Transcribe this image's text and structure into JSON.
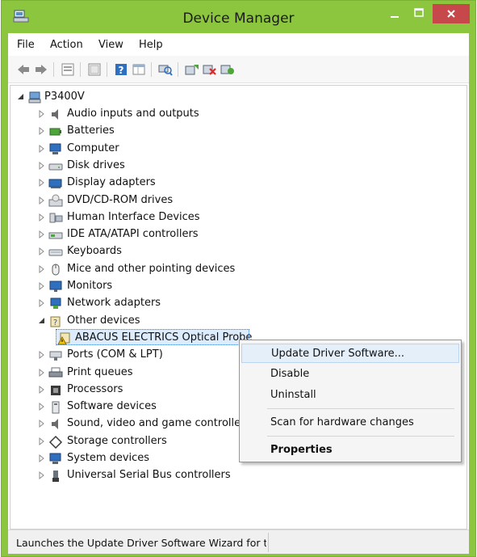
{
  "window": {
    "title": "Device Manager",
    "accent_color": "#8cc63e",
    "close_color": "#c7484a"
  },
  "menu": [
    "File",
    "Action",
    "View",
    "Help"
  ],
  "toolbar": {
    "icons": [
      "back-arrow-icon",
      "forward-arrow-icon",
      "properties-sheet-icon",
      "console-tree-icon",
      "help-icon",
      "grid-icon",
      "scan-hardware-icon",
      "update-driver-icon",
      "uninstall-device-icon",
      "add-legacy-icon"
    ]
  },
  "tree": {
    "root": "P3400V",
    "items": [
      {
        "label": "Audio inputs and outputs",
        "icon": "speaker-icon"
      },
      {
        "label": "Batteries",
        "icon": "battery-icon"
      },
      {
        "label": "Computer",
        "icon": "computer-icon"
      },
      {
        "label": "Disk drives",
        "icon": "disk-drive-icon"
      },
      {
        "label": "Display adapters",
        "icon": "display-adapter-icon"
      },
      {
        "label": "DVD/CD-ROM drives",
        "icon": "dvd-drive-icon"
      },
      {
        "label": "Human Interface Devices",
        "icon": "hid-icon"
      },
      {
        "label": "IDE ATA/ATAPI controllers",
        "icon": "ide-controller-icon"
      },
      {
        "label": "Keyboards",
        "icon": "keyboard-icon"
      },
      {
        "label": "Mice and other pointing devices",
        "icon": "mouse-icon"
      },
      {
        "label": "Monitors",
        "icon": "monitor-icon"
      },
      {
        "label": "Network adapters",
        "icon": "network-adapter-icon"
      },
      {
        "label": "Other devices",
        "icon": "other-devices-icon",
        "expanded": true
      },
      {
        "label": "ABACUS ELECTRICS Optical Probe",
        "icon": "warning-device-icon",
        "child": true,
        "selected": true
      },
      {
        "label": "Ports (COM & LPT)",
        "icon": "port-icon"
      },
      {
        "label": "Print queues",
        "icon": "printer-icon"
      },
      {
        "label": "Processors",
        "icon": "processor-icon"
      },
      {
        "label": "Software devices",
        "icon": "software-device-icon"
      },
      {
        "label": "Sound, video and game controllers",
        "icon": "sound-controller-icon"
      },
      {
        "label": "Storage controllers",
        "icon": "storage-controller-icon"
      },
      {
        "label": "System devices",
        "icon": "system-devices-icon"
      },
      {
        "label": "Universal Serial Bus controllers",
        "icon": "usb-icon"
      }
    ]
  },
  "context_menu": {
    "items": [
      {
        "label": "Update Driver Software...",
        "highlighted": true
      },
      {
        "label": "Disable"
      },
      {
        "label": "Uninstall"
      },
      {
        "label": "Scan for hardware changes"
      },
      {
        "label": "Properties",
        "bold": true
      }
    ]
  },
  "status": {
    "text": "Launches the Update Driver Software Wizard for the selected device."
  }
}
